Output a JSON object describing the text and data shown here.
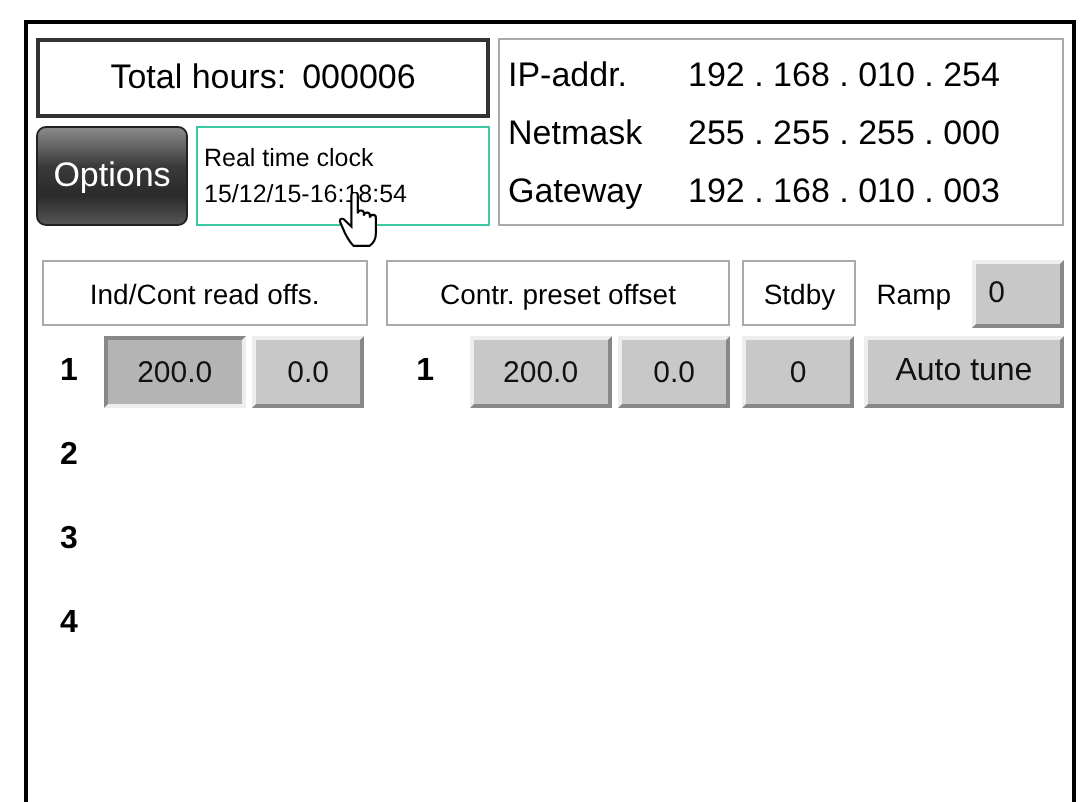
{
  "total_hours": {
    "label": "Total hours:",
    "value": "000006"
  },
  "options_button": "Options",
  "clock": {
    "label": "Real time clock",
    "value": "15/12/15-16:18:54"
  },
  "network": [
    {
      "label": "IP-addr.",
      "value": "192 . 168 . 010 . 254"
    },
    {
      "label": "Netmask",
      "value": "255 . 255 . 255 . 000"
    },
    {
      "label": "Gateway",
      "value": "192 . 168 . 010 . 003"
    }
  ],
  "headers": {
    "read_offsets": "Ind/Cont read offs.",
    "preset_offset": "Contr. preset  offset",
    "stdby": "Stdby",
    "ramp_label": "Ramp",
    "ramp_value": "0"
  },
  "channels": [
    {
      "number": "1",
      "read": [
        {
          "text": "200.0",
          "selected": true
        },
        {
          "text": "0.0",
          "selected": false
        }
      ],
      "control_number": "1",
      "preset": [
        {
          "text": "200.0",
          "selected": false
        },
        {
          "text": "0.0",
          "selected": false
        }
      ],
      "stdby": "0",
      "action": "Auto tune"
    },
    {
      "number": "2"
    },
    {
      "number": "3"
    },
    {
      "number": "4"
    }
  ]
}
